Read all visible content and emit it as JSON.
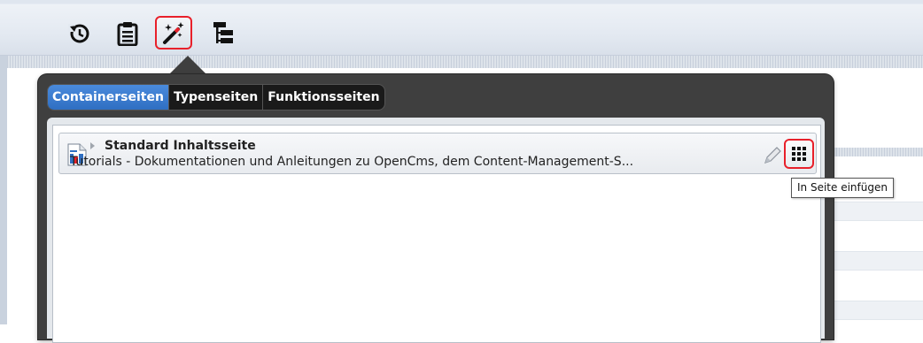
{
  "toolbar": {
    "buttons": [
      {
        "icon": "history-icon"
      },
      {
        "icon": "clipboard-icon"
      },
      {
        "icon": "magic-wand-icon",
        "active": true
      },
      {
        "icon": "sitemap-icon"
      }
    ],
    "highlight_color": "#e8202a"
  },
  "gallery": {
    "tabs": [
      {
        "label": "Containerseiten",
        "active": true
      },
      {
        "label": "Typenseiten",
        "active": false
      },
      {
        "label": "Funktionsseiten",
        "active": false
      }
    ],
    "items": [
      {
        "title": "Standard Inhaltsseite",
        "description": "Tutorials - Dokumentationen und Anleitungen zu OpenCms, dem Content-Management-S...",
        "icon": "document-chart-icon"
      }
    ]
  },
  "tooltip": {
    "text": "In Seite einfügen"
  },
  "colors": {
    "accent": "#2f6fc2",
    "dialog_bg": "#3f3f3f",
    "highlight": "#e8202a"
  }
}
